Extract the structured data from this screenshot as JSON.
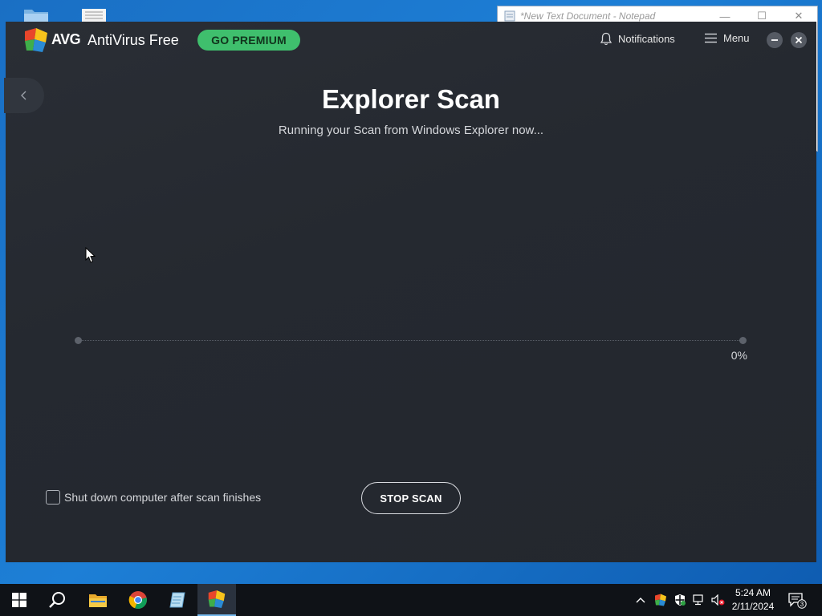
{
  "notepad": {
    "title": "*New Text Document - Notepad",
    "minimize": "—",
    "maximize": "☐",
    "close": "✕"
  },
  "app": {
    "brand": "AVG",
    "product": "AntiVirus Free",
    "premium_button": "GO PREMIUM",
    "notifications_label": "Notifications",
    "menu_label": "Menu"
  },
  "scan": {
    "title": "Explorer Scan",
    "subtitle": "Running your Scan from Windows Explorer now...",
    "progress_fraction": 0,
    "progress_text": "0%",
    "shutdown_label": "Shut down computer after scan finishes",
    "shutdown_checked": false,
    "stop_button": "STOP SCAN"
  },
  "taskbar": {
    "items": [
      "start-icon",
      "search-icon",
      "file-explorer-icon",
      "chrome-icon",
      "notepad-icon",
      "avg-icon"
    ],
    "active_item": "avg-icon",
    "tray_icons": [
      "chevron-up-icon",
      "avg-tray-icon",
      "defender-icon",
      "network-icon",
      "volume-muted-icon"
    ],
    "time": "5:24 AM",
    "date": "2/11/2024",
    "notification_count": "3"
  },
  "colors": {
    "accent_green": "#3fbf6d",
    "window_bg": "#262a31",
    "desktop_blue": "#1a6fc4",
    "taskbar_bg": "#0f1217"
  }
}
